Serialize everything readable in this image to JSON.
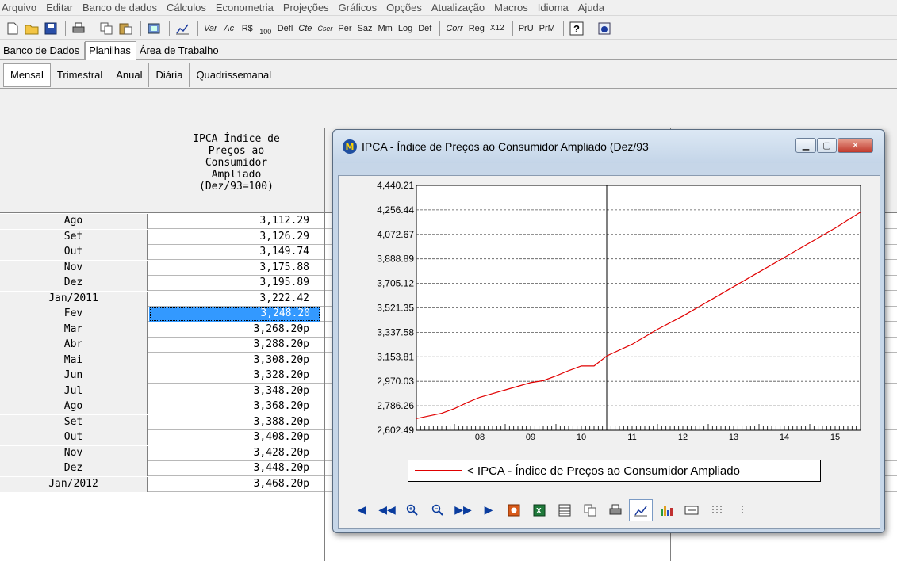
{
  "menu": [
    "Arquivo",
    "Editar",
    "Banco de dados",
    "Cálculos",
    "Econometria",
    "Projeções",
    "Gráficos",
    "Opções",
    "Atualização",
    "Macros",
    "Idioma",
    "Ajuda"
  ],
  "toolbar": {
    "text_buttons_a": [
      "Var",
      "Ac",
      "R$"
    ],
    "index_label": "100",
    "text_buttons_b": [
      "Defl",
      "Cte",
      "Cser",
      "Per",
      "Saz",
      "Mm",
      "Log",
      "Def"
    ],
    "text_buttons_c": [
      "Corr",
      "Reg",
      "X12"
    ],
    "text_buttons_d": [
      "PrU",
      "PrM"
    ]
  },
  "tabs_main": [
    "Banco de Dados",
    "Planilhas",
    "Área de Trabalho"
  ],
  "tabs_main_active": "Planilhas",
  "tabs_freq": [
    "Mensal",
    "Trimestral",
    "Anual",
    "Diária",
    "Quadrissemanal"
  ],
  "tabs_freq_active": "Mensal",
  "grid": {
    "column_header": [
      "IPCA Índice de",
      "Preços ao",
      "Consumidor",
      "Ampliado",
      "(Dez/93=100)"
    ],
    "rows": [
      {
        "label": "Ago",
        "value": "3,112.29"
      },
      {
        "label": "Set",
        "value": "3,126.29"
      },
      {
        "label": "Out",
        "value": "3,149.74"
      },
      {
        "label": "Nov",
        "value": "3,175.88"
      },
      {
        "label": "Dez",
        "value": "3,195.89"
      },
      {
        "label": "Jan/2011",
        "value": "3,222.42"
      },
      {
        "label": "Fev",
        "value": "3,248.20"
      },
      {
        "label": "Mar",
        "value": "3,268.20p"
      },
      {
        "label": "Abr",
        "value": "3,288.20p"
      },
      {
        "label": "Mai",
        "value": "3,308.20p"
      },
      {
        "label": "Jun",
        "value": "3,328.20p"
      },
      {
        "label": "Jul",
        "value": "3,348.20p"
      },
      {
        "label": "Ago",
        "value": "3,368.20p"
      },
      {
        "label": "Set",
        "value": "3,388.20p"
      },
      {
        "label": "Out",
        "value": "3,408.20p"
      },
      {
        "label": "Nov",
        "value": "3,428.20p"
      },
      {
        "label": "Dez",
        "value": "3,448.20p"
      },
      {
        "label": "Jan/2012",
        "value": "3,468.20p"
      }
    ],
    "selected_row": 6
  },
  "popup": {
    "title": "IPCA - Índice de Preços ao Consumidor Ampliado (Dez/93",
    "logo_letter": "M",
    "legend": "< IPCA - Índice de Preços ao Consumidor Ampliado"
  },
  "chart_data": {
    "type": "line",
    "title": "",
    "xlabel": "",
    "ylabel": "",
    "y_ticks": [
      "4,440.21",
      "4,256.44",
      "4,072.67",
      "3,888.89",
      "3,705.12",
      "3,521.35",
      "3,337.58",
      "3,153.81",
      "2,970.03",
      "2,786.26",
      "2,602.49"
    ],
    "ylim": [
      2602.49,
      4440.21
    ],
    "x_ticks": [
      "08",
      "09",
      "10",
      "11",
      "12",
      "13",
      "14",
      "15"
    ],
    "xlim": [
      2007.25,
      2016.0
    ],
    "grid": "horizontal dashed",
    "cursor_x": 2011.0,
    "series": [
      {
        "name": "IPCA - Índice de Preços ao Consumidor Ampliado",
        "color": "#e00000",
        "x": [
          2007.25,
          2007.75,
          2008.0,
          2008.25,
          2008.5,
          2009.0,
          2009.5,
          2009.75,
          2010.0,
          2010.25,
          2010.5,
          2010.75,
          2011.0,
          2011.5,
          2012.0,
          2012.5,
          2013.0,
          2013.5,
          2014.0,
          2014.5,
          2015.0,
          2015.5,
          2016.0
        ],
        "y": [
          2690,
          2730,
          2765,
          2810,
          2850,
          2905,
          2960,
          2975,
          3010,
          3050,
          3085,
          3085,
          3160,
          3248,
          3360,
          3460,
          3570,
          3680,
          3790,
          3900,
          4010,
          4120,
          4240
        ]
      }
    ]
  }
}
